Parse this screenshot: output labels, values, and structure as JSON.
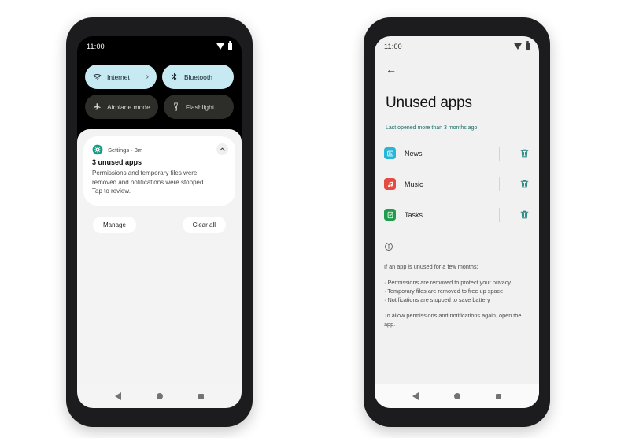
{
  "theme": {
    "tile_on_bg": "#c7e9f1",
    "tile_off_bg": "#2d2d2a",
    "accent_teal": "#186e66",
    "trash_teal": "#2f8a84",
    "gear_teal": "#0f9d84"
  },
  "left_phone": {
    "name": "quick-settings-notification-shade",
    "status_bar": {
      "time": "11:00",
      "wifi_icon": "wifi-icon",
      "battery_icon": "battery-icon"
    },
    "quick_settings": {
      "tiles": [
        {
          "label": "Internet",
          "icon": "wifi-icon",
          "state": "on",
          "chevron": "›"
        },
        {
          "label": "Bluetooth",
          "icon": "bluetooth-icon",
          "state": "on"
        },
        {
          "label": "Airplane mode",
          "icon": "airplane-icon",
          "state": "off"
        },
        {
          "label": "Flashlight",
          "icon": "flashlight-icon",
          "state": "off"
        }
      ]
    },
    "notification": {
      "app_icon": "settings-gear-icon",
      "source": "Settings · 3m",
      "title": "3 unused apps",
      "body": "Permissions and temporary files were removed and notifications were stopped. Tap to review.",
      "collapse_icon": "chevron-up-icon"
    },
    "actions": {
      "manage": "Manage",
      "clear_all": "Clear all"
    },
    "nav_bar": {
      "back": "back-icon",
      "home": "home-icon",
      "recents": "recents-icon"
    }
  },
  "right_phone": {
    "name": "unused-apps-settings-page",
    "status_bar": {
      "time": "11:00",
      "wifi_icon": "wifi-icon",
      "battery_icon": "battery-icon"
    },
    "back_arrow": "←",
    "title": "Unused apps",
    "subtitle": "Last opened more than 3 months ago",
    "apps": [
      {
        "name": "News",
        "icon": "news-app-icon",
        "icon_color": "#28b5d6",
        "action": "delete-icon"
      },
      {
        "name": "Music",
        "icon": "music-app-icon",
        "icon_color": "#e54b40",
        "action": "delete-icon"
      },
      {
        "name": "Tasks",
        "icon": "tasks-app-icon",
        "icon_color": "#1f9d4d",
        "action": "delete-icon"
      }
    ],
    "info": {
      "icon": "info-icon",
      "heading": "If an app is unused for a few months:",
      "bullets": [
        "· Permissions are removed to protect your privacy",
        "· Temporary files are removed to free up space",
        "· Notifications are stopped to save battery"
      ],
      "footer": "To allow permissions and notifications again, open the app."
    },
    "nav_bar": {
      "back": "back-icon",
      "home": "home-icon",
      "recents": "recents-icon"
    }
  }
}
